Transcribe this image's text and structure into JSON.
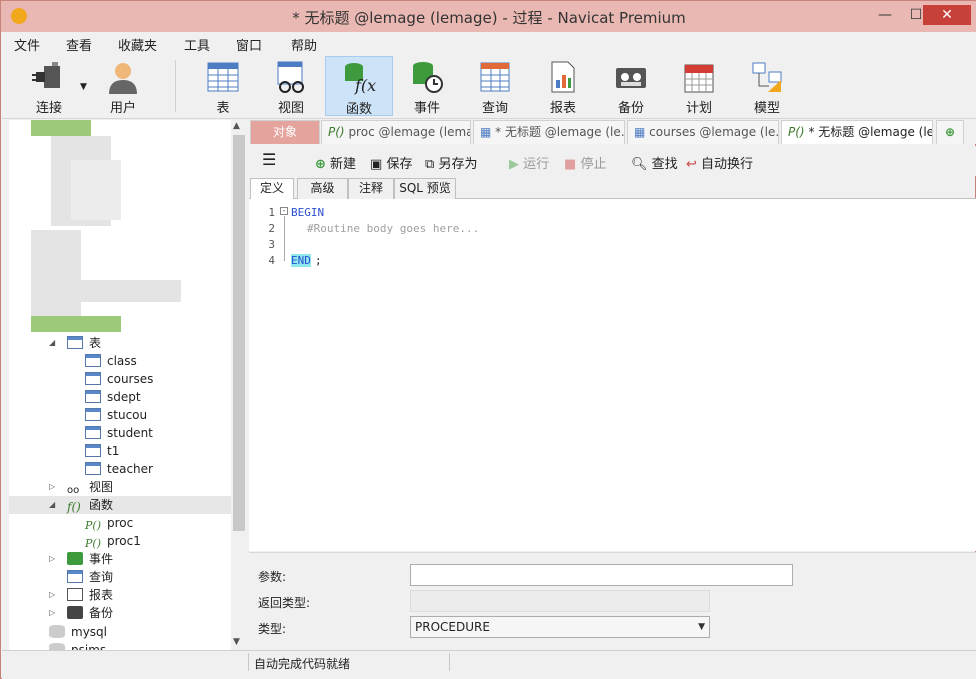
{
  "window": {
    "title": "* 无标题 @lemage (lemage) - 过程 - Navicat Premium",
    "min": "—",
    "max": "☐",
    "close": "✕"
  },
  "menu": [
    "文件",
    "查看",
    "收藏夹",
    "工具",
    "窗口",
    "帮助"
  ],
  "toolbar": [
    "连接",
    "用户",
    "表",
    "视图",
    "函数",
    "事件",
    "查询",
    "报表",
    "备份",
    "计划",
    "模型"
  ],
  "tree": {
    "tables_label": "表",
    "tables": [
      "class",
      "courses",
      "sdept",
      "stucou",
      "student",
      "t1",
      "teacher"
    ],
    "views": "视图",
    "functions": "函数",
    "funcs": [
      "proc",
      "proc1"
    ],
    "events": "事件",
    "queries": "查询",
    "reports": "报表",
    "backups": "备份",
    "db_mysql": "mysql",
    "db_partial": "psims"
  },
  "tabs": {
    "object": "对象",
    "t1": "proc @lemage (lema...",
    "t2": "* 无标题 @lemage (le...",
    "t3": "courses @lemage (le...",
    "t4": "* 无标题 @lemage (le..."
  },
  "editor_toolbar": {
    "new": "新建",
    "save": "保存",
    "save_as": "另存为",
    "run": "运行",
    "stop": "停止",
    "find": "查找",
    "wrap": "自动换行"
  },
  "subtabs": [
    "定义",
    "高级",
    "注释",
    "SQL 预览"
  ],
  "code": {
    "lines": [
      "1",
      "2",
      "3",
      "4"
    ],
    "l1": "BEGIN",
    "l2": "#Routine body goes here...",
    "l4": "END",
    "semi": ";"
  },
  "props": {
    "params_label": "参数:",
    "return_label": "返回类型:",
    "type_label": "类型:",
    "type_value": "PROCEDURE"
  },
  "status": "自动完成代码就绪",
  "colors": {
    "accent": "#e5a39d",
    "keyword": "#2a4fd0",
    "comment": "#a0a0a0"
  }
}
